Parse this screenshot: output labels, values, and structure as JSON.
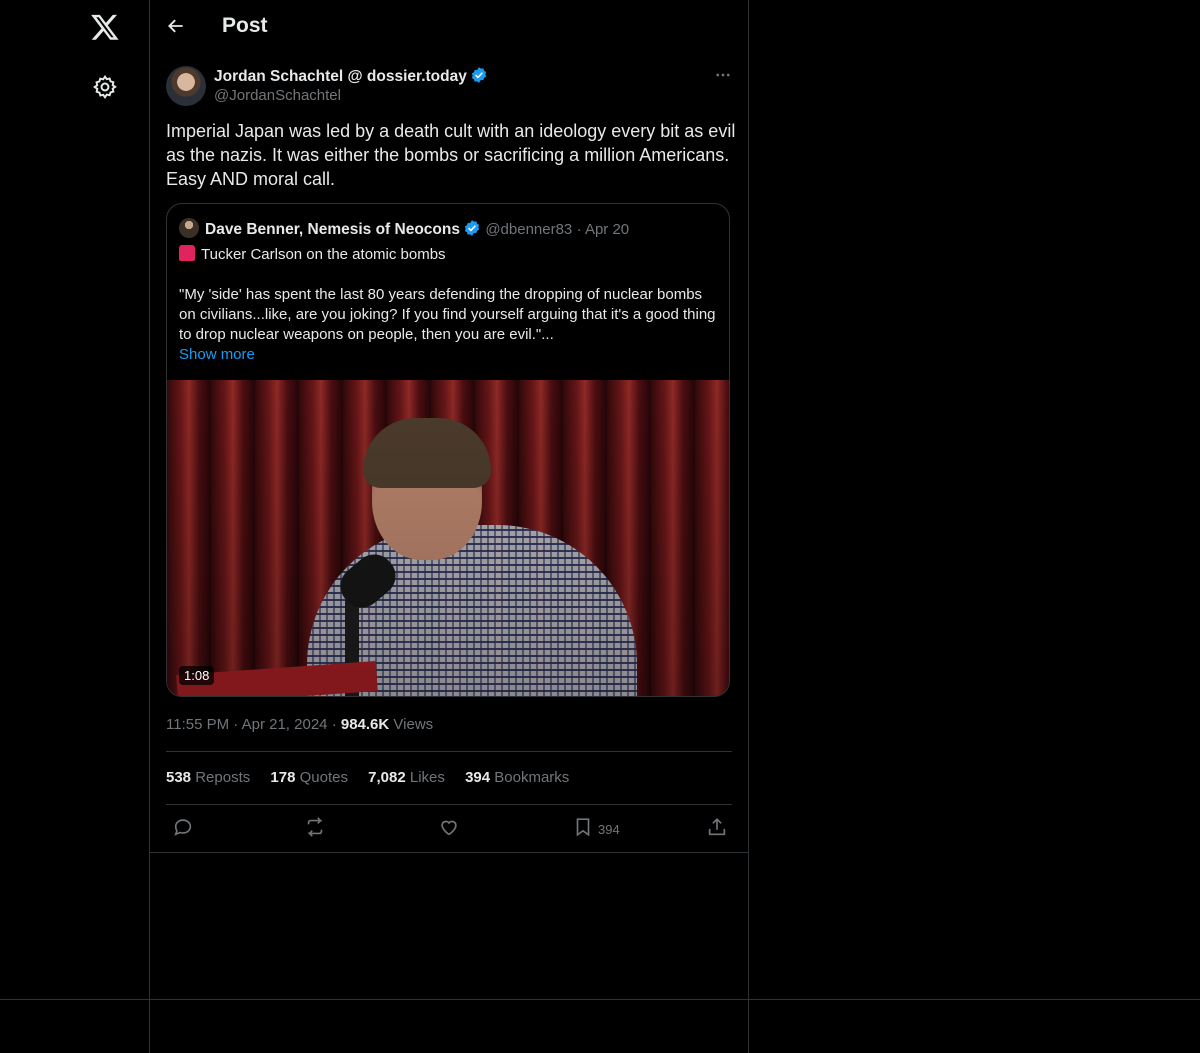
{
  "header": {
    "title": "Post"
  },
  "post": {
    "author_name": "Jordan Schachtel @ dossier.today",
    "author_handle": "@JordanSchachtel",
    "text": "Imperial Japan was led by a death cult with an ideology every bit as evil as the nazis. It was either the bombs or sacrificing a million Americans. Easy AND moral call.",
    "time": "11:55 PM",
    "date": "Apr 21, 2024",
    "views_count": "984.6K",
    "views_label": "Views"
  },
  "quote": {
    "author_name": "Dave Benner, Nemesis of Neocons",
    "author_handle": "@dbenner83",
    "date": "Apr 20",
    "line1": "Tucker Carlson on the atomic bombs",
    "body": "\"My 'side' has spent the last 80 years defending the dropping of nuclear bombs on civilians...like, are you joking? If you find yourself arguing that it's a good thing to drop nuclear weapons on people, then you are evil.\"...",
    "show_more": "Show more",
    "video_duration": "1:08"
  },
  "stats": {
    "reposts_count": "538",
    "reposts_label": "Reposts",
    "quotes_count": "178",
    "quotes_label": "Quotes",
    "likes_count": "7,082",
    "likes_label": "Likes",
    "bookmarks_count": "394",
    "bookmarks_label": "Bookmarks"
  },
  "actions": {
    "bookmark_count": "394"
  },
  "colors": {
    "accent": "#1d9bf0",
    "background": "#000000",
    "border": "#2f3336",
    "muted": "#71767b"
  },
  "icons": [
    "x-logo-icon",
    "gear-icon",
    "back-arrow-icon",
    "verified-icon",
    "more-icon",
    "reply-icon",
    "repost-icon",
    "like-icon",
    "bookmark-icon",
    "share-icon"
  ]
}
